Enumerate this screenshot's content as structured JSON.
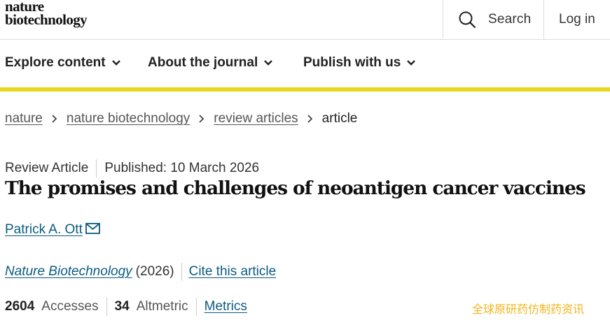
{
  "header": {
    "logo_line1": "nature",
    "logo_line2": "biotechnology",
    "search_label": "Search",
    "login_label": "Log in"
  },
  "nav": {
    "items": [
      {
        "label": "Explore content"
      },
      {
        "label": "About the journal"
      },
      {
        "label": "Publish with us"
      }
    ],
    "accent_color": "#e6d91b"
  },
  "breadcrumb": {
    "items": [
      {
        "label": "nature"
      },
      {
        "label": "nature biotechnology"
      },
      {
        "label": "review articles"
      },
      {
        "label": "article"
      }
    ]
  },
  "article": {
    "type": "Review Article",
    "published": "Published: 10 March 2026",
    "title": "The promises and challenges of neoantigen cancer vaccines",
    "author": "Patrick A. Ott",
    "journal": "Nature Biotechnology",
    "year": "(2026)",
    "cite_label": "Cite this article",
    "accesses_count": "2604",
    "accesses_label": "Accesses",
    "altmetric_count": "34",
    "altmetric_label": "Altmetric",
    "metrics_label": "Metrics",
    "link_color": "#0b5b81"
  },
  "watermark": "全球原研药仿制药资讯",
  "icons": [
    "search-icon",
    "chevron-down-icon",
    "chevron-right-icon",
    "mail-icon"
  ]
}
